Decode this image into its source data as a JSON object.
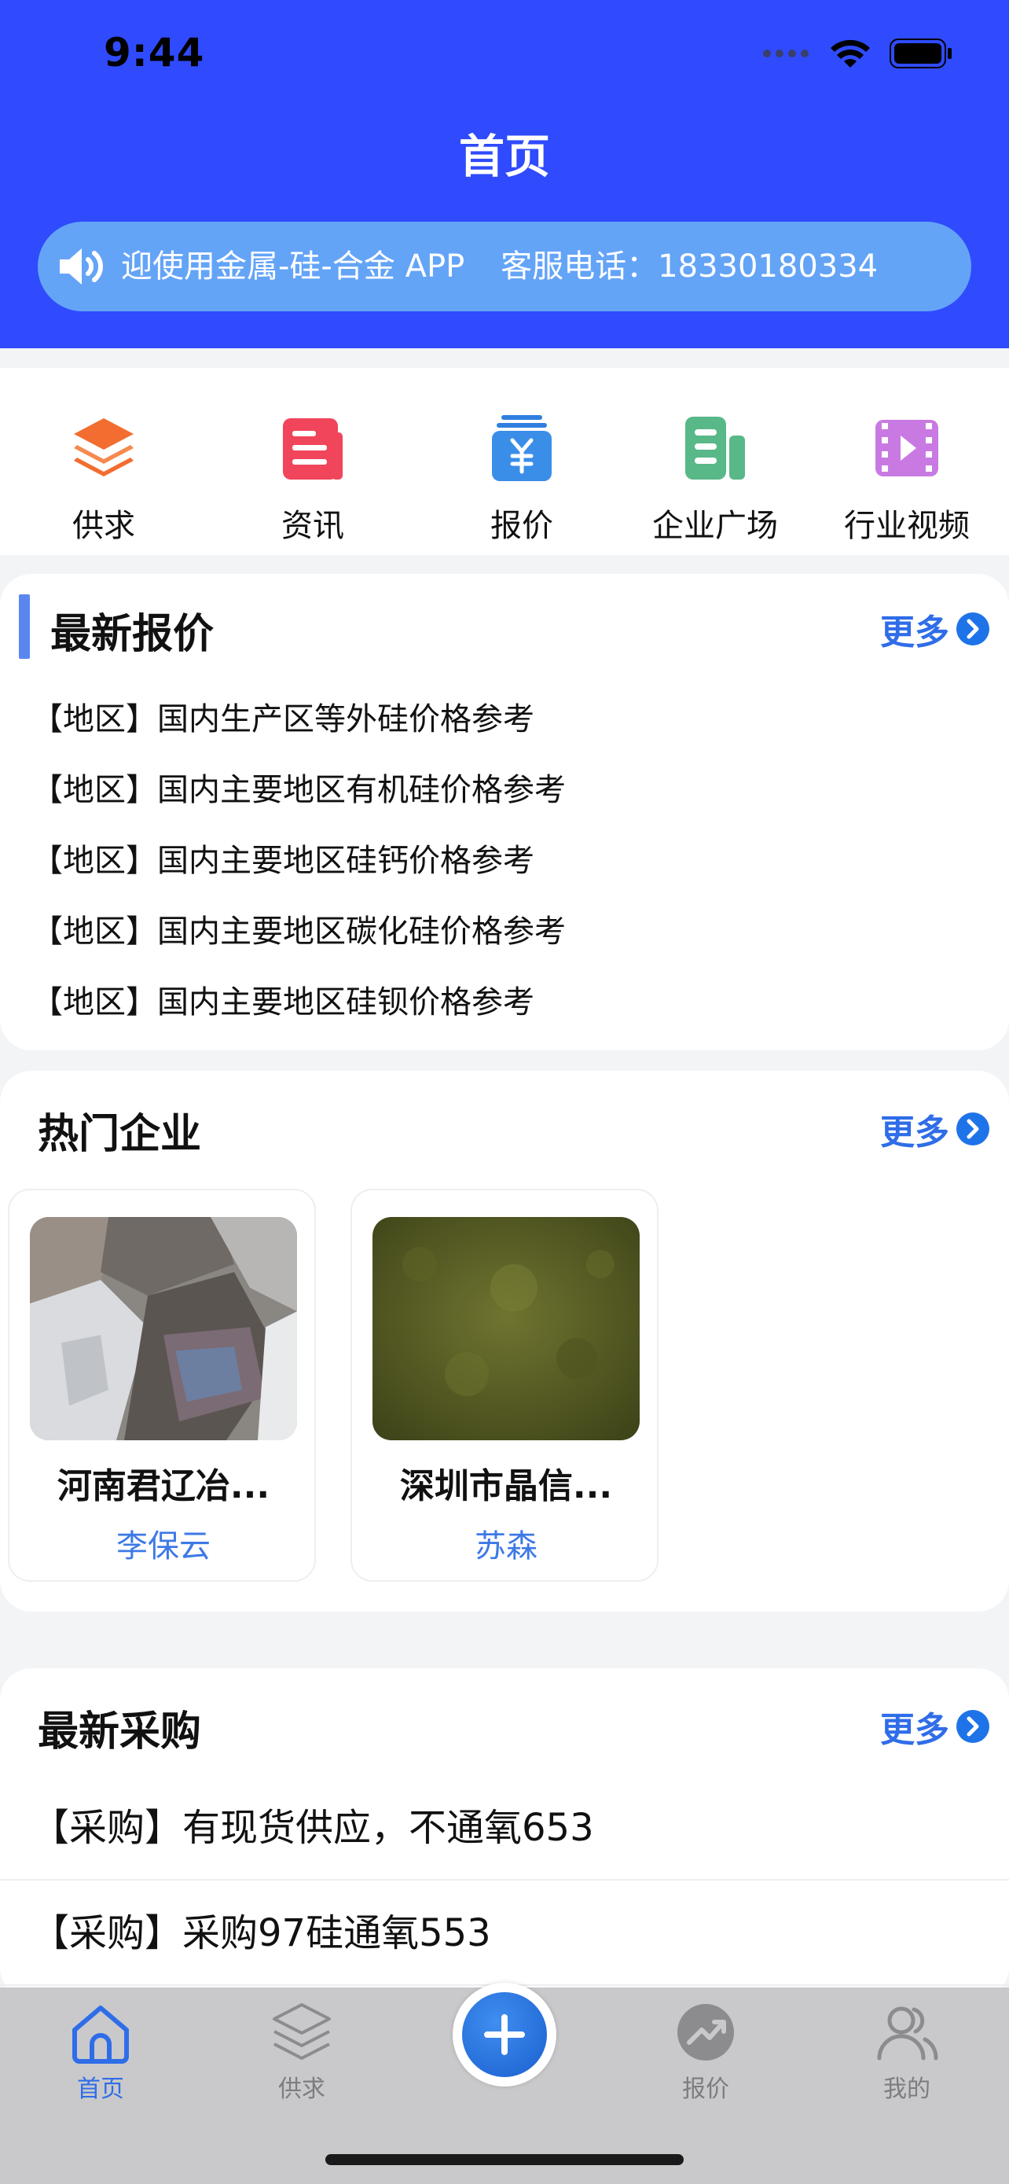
{
  "status_bar": {
    "time": "9:44"
  },
  "header": {
    "title": "首页",
    "notice_welcome": "迎使用金属-硅-合金 APP",
    "notice_service": "客服电话：18330180334"
  },
  "quick_nav": [
    {
      "label": "供求",
      "icon": "layers-icon"
    },
    {
      "label": "资讯",
      "icon": "news-icon"
    },
    {
      "label": "报价",
      "icon": "yen-price-icon"
    },
    {
      "label": "企业广场",
      "icon": "enterprise-icon"
    },
    {
      "label": "行业视频",
      "icon": "video-icon"
    }
  ],
  "latest_prices": {
    "title": "最新报价",
    "more": "更多",
    "items": [
      "【地区】国内生产区等外硅价格参考",
      "【地区】国内主要地区有机硅价格参考",
      "【地区】国内主要地区硅钙价格参考",
      "【地区】国内主要地区碳化硅价格参考",
      "【地区】国内主要地区硅钡价格参考"
    ]
  },
  "hot_enterprises": {
    "title": "热门企业",
    "more": "更多",
    "items": [
      {
        "name": "河南君辽冶...",
        "contact": "李保云"
      },
      {
        "name": "深圳市晶信...",
        "contact": "苏森"
      }
    ]
  },
  "latest_purchases": {
    "title": "最新采购",
    "more": "更多",
    "items": [
      "【采购】有现货供应，不通氧653",
      "【采购】采购97硅通氧553"
    ]
  },
  "tabbar": {
    "home": "首页",
    "supply": "供求",
    "price": "报价",
    "mine": "我的"
  },
  "colors": {
    "header_blue": "#2f4bfd",
    "notice_blue": "#64a4f7",
    "link_blue": "#2f6de8",
    "tabbar_bg": "#c9c9cb"
  }
}
